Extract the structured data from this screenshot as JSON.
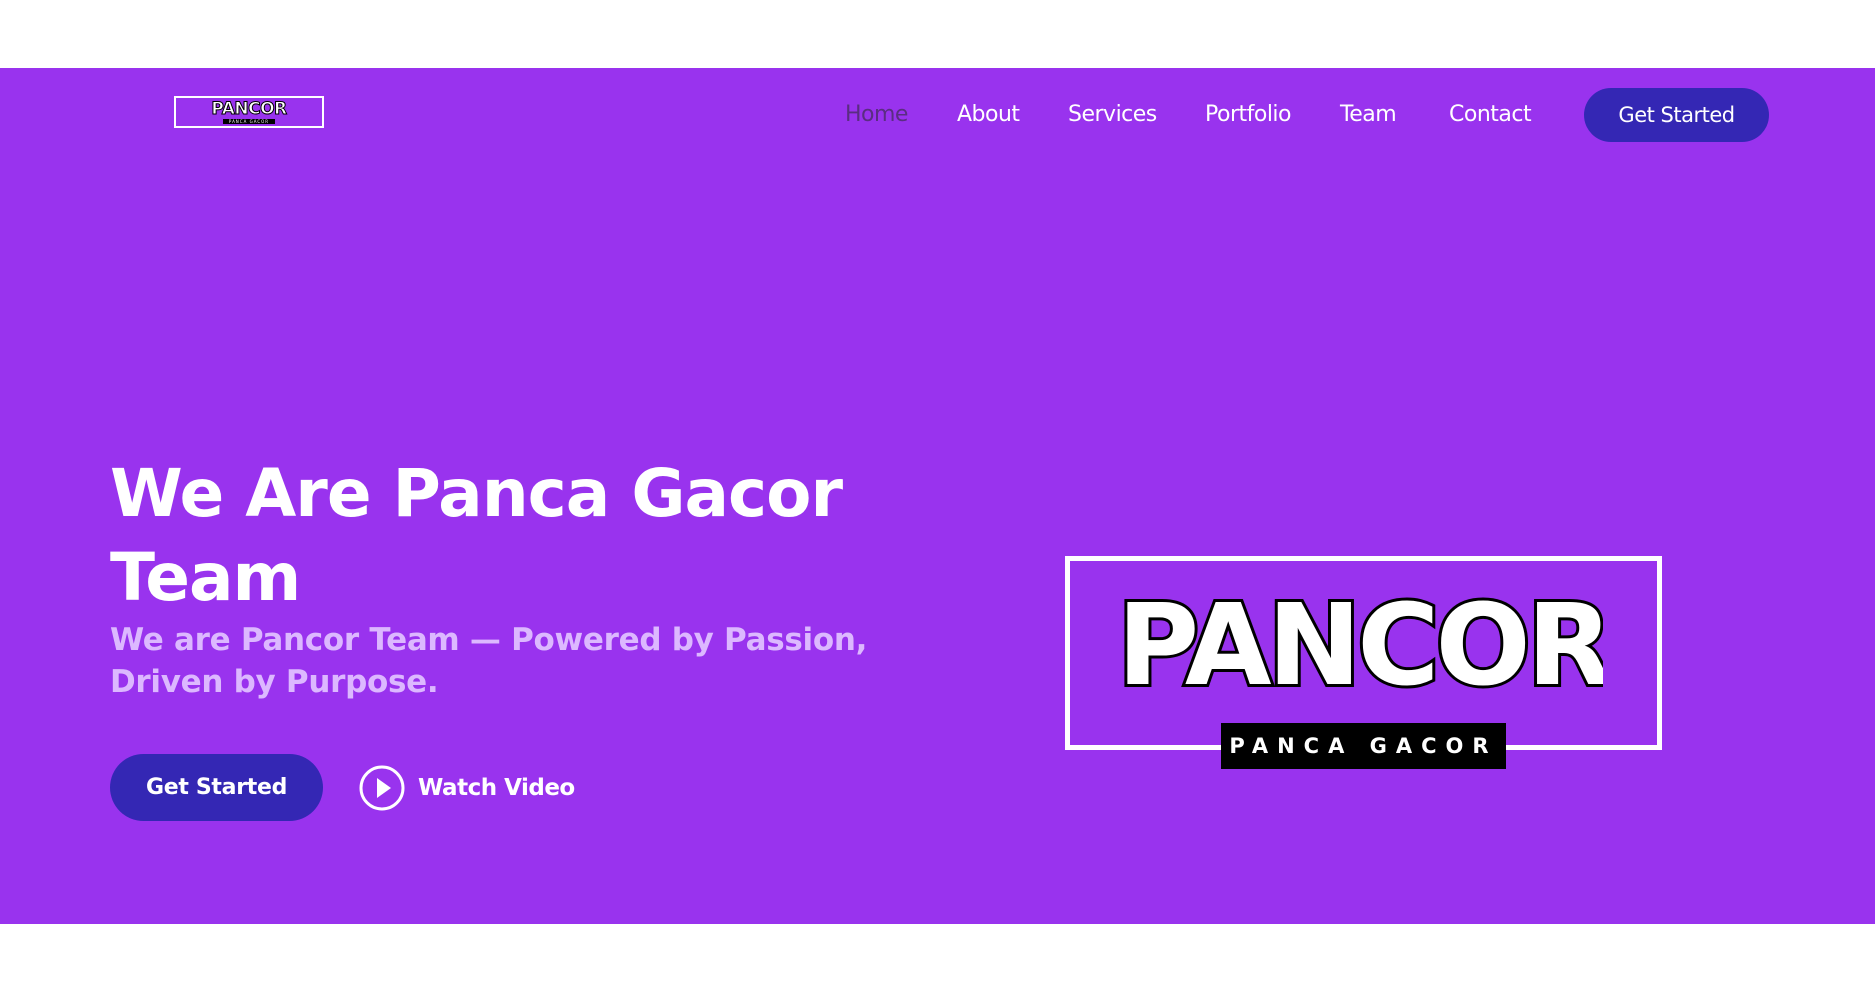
{
  "brand": {
    "logo_text": "PANCOR",
    "logo_tagline": "PANCA GACOR"
  },
  "nav": {
    "items": [
      {
        "label": "Home",
        "active": true
      },
      {
        "label": "About"
      },
      {
        "label": "Services"
      },
      {
        "label": "Portfolio"
      },
      {
        "label": "Team"
      },
      {
        "label": "Contact"
      }
    ],
    "cta_label": "Get Started"
  },
  "hero": {
    "headline": "We Are Panca Gacor Team",
    "subtitle": "We are Pancor Team — Powered by Passion, Driven by Purpose.",
    "cta_label": "Get Started",
    "video_label": "Watch Video",
    "video_icon": "play-circle-icon"
  },
  "colors": {
    "hero_bg": "#9933ee",
    "button_bg": "#3427b4",
    "nav_active": "#5a2d82",
    "subtitle": "#dcb8ff"
  }
}
